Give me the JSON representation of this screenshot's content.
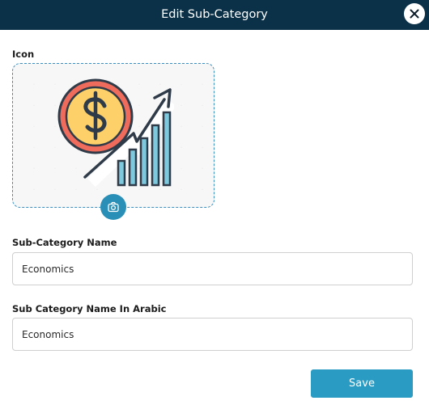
{
  "header": {
    "title": "Edit Sub-Category",
    "close_icon": "close-icon"
  },
  "icon_field": {
    "label": "Icon",
    "image_icon": "dollar-coin-growth-chart-icon",
    "upload_icon": "camera-icon"
  },
  "name_field": {
    "label": "Sub-Category Name",
    "value": "Economics"
  },
  "arabic_name_field": {
    "label": "Sub Category Name In Arabic",
    "value": "Economics"
  },
  "actions": {
    "save_label": "Save"
  },
  "colors": {
    "header_bg": "#0b3148",
    "accent": "#2a9bc2",
    "coin_fill": "#fdd069",
    "coin_ring": "#ef6b5b",
    "bar_fill": "#7ec9dd",
    "outline": "#2f3b48"
  }
}
